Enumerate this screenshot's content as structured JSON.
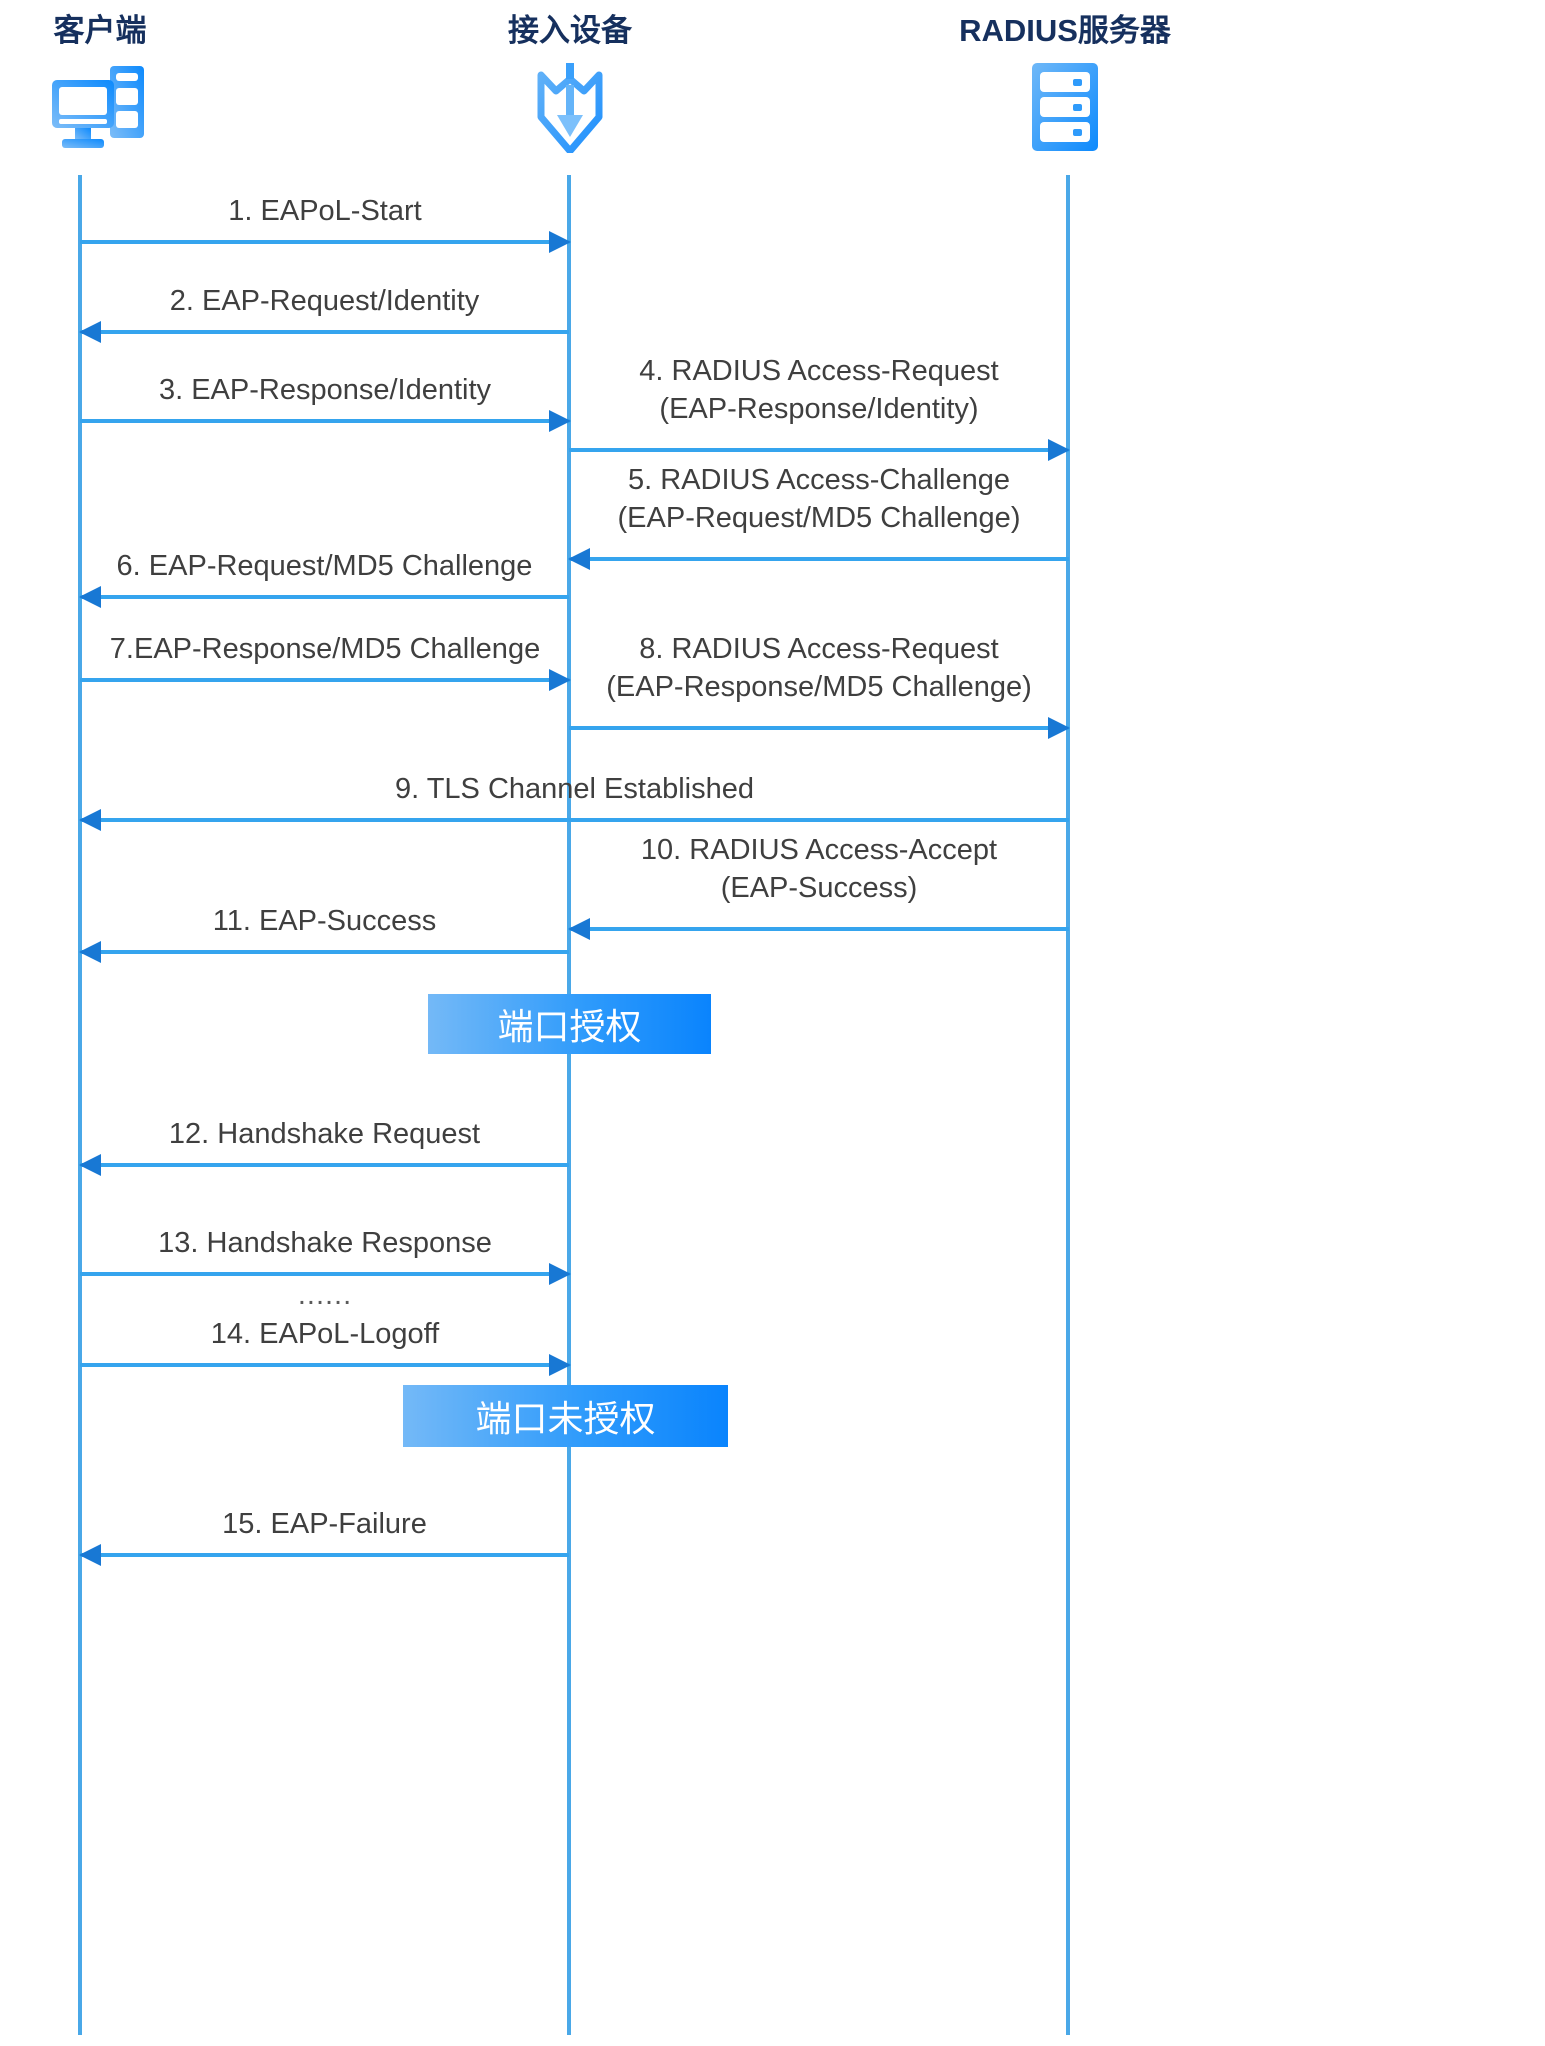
{
  "diagram": {
    "title_hidden": "",
    "actors": [
      {
        "id": "client",
        "label": "客户端",
        "icon": "desktop-computer-icon"
      },
      {
        "id": "device",
        "label": "接入设备",
        "icon": "access-device-shield-arrow-icon"
      },
      {
        "id": "radius",
        "label": "RADIUS服务器",
        "icon": "server-rack-icon"
      }
    ],
    "messages": [
      {
        "n": "1",
        "label": "1. EAPoL-Start",
        "from": "client",
        "to": "device"
      },
      {
        "n": "2",
        "label": "2. EAP-Request/Identity",
        "from": "device",
        "to": "client"
      },
      {
        "n": "3",
        "label": "3. EAP-Response/Identity",
        "from": "client",
        "to": "device"
      },
      {
        "n": "4",
        "label": "4. RADIUS Access-Request\n(EAP-Response/Identity)",
        "from": "device",
        "to": "radius"
      },
      {
        "n": "5",
        "label": "5. RADIUS Access-Challenge\n(EAP-Request/MD5 Challenge)",
        "from": "radius",
        "to": "device"
      },
      {
        "n": "6",
        "label": "6. EAP-Request/MD5 Challenge",
        "from": "device",
        "to": "client"
      },
      {
        "n": "7",
        "label": "7.EAP-Response/MD5 Challenge",
        "from": "client",
        "to": "device"
      },
      {
        "n": "8",
        "label": "8. RADIUS Access-Request\n(EAP-Response/MD5 Challenge)",
        "from": "device",
        "to": "radius"
      },
      {
        "n": "9",
        "label": "9. TLS Channel Established",
        "from": "radius",
        "to": "client"
      },
      {
        "n": "10",
        "label": "10. RADIUS Access-Accept\n(EAP-Success)",
        "from": "radius",
        "to": "device"
      },
      {
        "n": "11",
        "label": "11. EAP-Success",
        "from": "device",
        "to": "client"
      },
      {
        "n": "12",
        "label": "12. Handshake Request",
        "from": "device",
        "to": "client"
      },
      {
        "n": "13",
        "label": "13. Handshake Response",
        "from": "client",
        "to": "device"
      },
      {
        "n": "14",
        "label": "14. EAPoL-Logoff",
        "from": "client",
        "to": "device",
        "dots": "......"
      },
      {
        "n": "15",
        "label": "15. EAP-Failure",
        "from": "device",
        "to": "client"
      }
    ],
    "state_boxes": [
      {
        "id": "authorized",
        "label": "端口授权"
      },
      {
        "id": "unauthorized",
        "label": "端口未授权"
      }
    ],
    "colors": {
      "actor_title": "#16305e",
      "lifeline": "#4aa8e8",
      "arrow_line": "#35a4ee",
      "arrow_head": "#1878d4",
      "message_text": "#3f3f3f",
      "icon_blue_light": "#74b9f7",
      "icon_blue": "#2f9bfb",
      "icon_blue_dark": "#0a84fd",
      "state_box_text": "#ffffff"
    }
  }
}
